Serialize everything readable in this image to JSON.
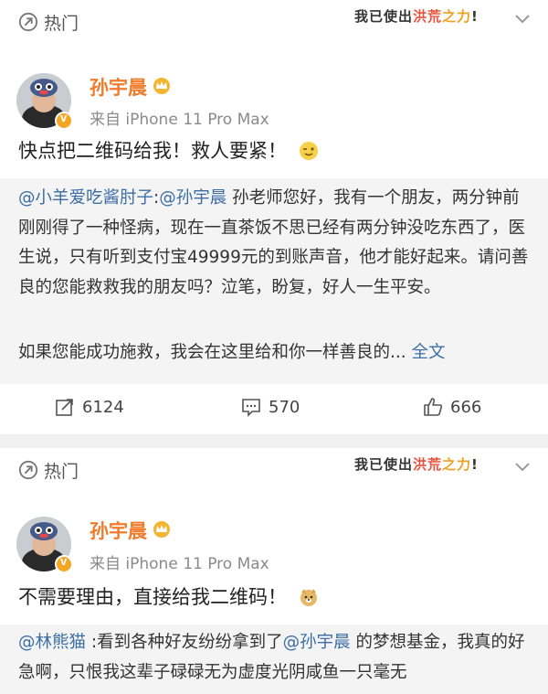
{
  "posts": [
    {
      "hot_label": "热门",
      "badge": {
        "part1": "我已使出",
        "part2": "洪荒",
        "part3": "之力",
        "suffix": "!"
      },
      "username": "孙宇晨",
      "source": "来自 iPhone 11 Pro Max",
      "content": "快点把二维码给我！救人要紧！",
      "emoji": "wink-emoji",
      "repost": {
        "mention": "@小羊爱吃酱肘子",
        "colon": ":",
        "reply_mention": "@孙宇晨",
        "text_a": " 孙老师您好，我有一个朋友，两分钟前刚刚得了一种怪病，现在一直茶饭不思已经有两分钟没吃东西了，医生说，只有听到支付宝49999元的到账声音，他才能好起来。请问善良的您能救救我的朋友吗？泣笔，盼复，好人一生平安。",
        "text_b": "如果您能成功施救，我会在这里给和你一样善良的...",
        "full_text": " 全文"
      },
      "actions": {
        "reposts": "6124",
        "comments": "570",
        "likes": "666"
      }
    },
    {
      "hot_label": "热门",
      "badge": {
        "part1": "我已使出",
        "part2": "洪荒",
        "part3": "之力",
        "suffix": "!"
      },
      "username": "孙宇晨",
      "source": "来自 iPhone 11 Pro Max",
      "content": "不需要理由，直接给我二维码！",
      "emoji": "doge-emoji",
      "repost": {
        "mention": "@林熊猫",
        "text_a": " :看到各种好友纷纷拿到了",
        "mention2": "@孙宇晨",
        "text_b": " 的梦想基金，我真的好急啊，只恨我这辈子碌碌无为虚度光阴咸鱼一只毫无"
      }
    }
  ],
  "colors": {
    "username": "#f07b2b",
    "link": "#3c6ea5",
    "gap": "#f0f0f0"
  }
}
